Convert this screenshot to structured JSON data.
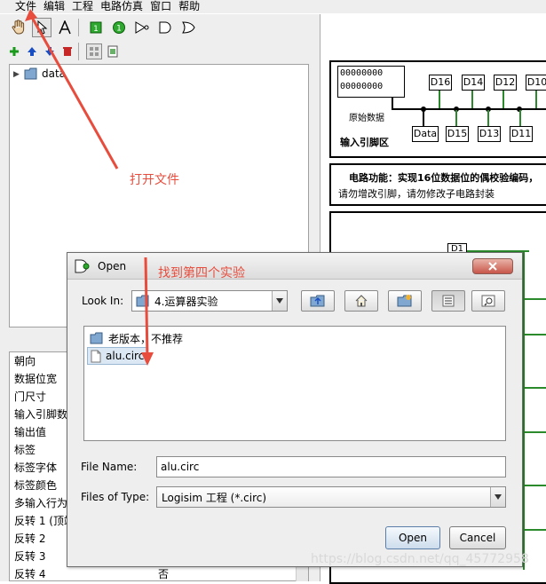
{
  "menu": [
    "文件",
    "编辑",
    "工程",
    "电路仿真",
    "窗口",
    "帮助"
  ],
  "tree": {
    "root_label": "data"
  },
  "properties": [
    {
      "name": "朝向",
      "value": ""
    },
    {
      "name": "数据位宽",
      "value": ""
    },
    {
      "name": "门尺寸",
      "value": ""
    },
    {
      "name": "输入引脚数",
      "value": ""
    },
    {
      "name": "输出值",
      "value": ""
    },
    {
      "name": "标签",
      "value": ""
    },
    {
      "name": "标签字体",
      "value": ""
    },
    {
      "name": "标签颜色",
      "value": ""
    },
    {
      "name": "多输入行为",
      "value": ""
    },
    {
      "name": "反转 1 (顶端)",
      "value": ""
    },
    {
      "name": "反转 2",
      "value": ""
    },
    {
      "name": "反转 3",
      "value": ""
    },
    {
      "name": "反转 4",
      "value": "否"
    }
  ],
  "canvas": {
    "bits_row1": "00000000",
    "bits_row2": "00000000",
    "raw_data_label": "原始数据",
    "pin_area_label": "输入引脚区",
    "top_pins": [
      "D16",
      "D14",
      "D12",
      "D10"
    ],
    "bottom_pins": [
      "Data",
      "D15",
      "D13",
      "D11"
    ],
    "function_text": "电路功能：实现16位数据位的偶校验编码，",
    "warning_text": "请勿增改引脚，请勿修改子电路封装",
    "d1_label": "D1"
  },
  "dialog": {
    "title": "Open",
    "look_in_label": "Look In:",
    "look_in_value": "4.运算器实验",
    "files": [
      {
        "name": "老版本，不推荐",
        "type": "folder"
      },
      {
        "name": "alu.circ",
        "type": "file"
      }
    ],
    "file_name_label": "File Name:",
    "file_name_value": "alu.circ",
    "files_of_type_label": "Files of Type:",
    "files_of_type_value": "Logisim 工程 (*.circ)",
    "open_button": "Open",
    "cancel_button": "Cancel"
  },
  "annotations": {
    "open_file": "打开文件",
    "find_fourth": "找到第四个实验"
  },
  "watermark": "https://blog.csdn.net/qq_45772958",
  "colors": {
    "annotation": "#e74c3c",
    "wire_green": "#2b8a2b"
  }
}
